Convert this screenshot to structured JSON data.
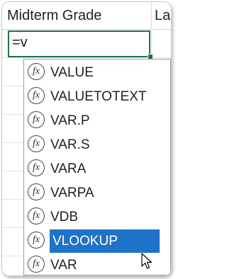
{
  "header": {
    "col1": "Midterm Grade",
    "col2": "La"
  },
  "active_cell": {
    "value": "=v"
  },
  "autocomplete": {
    "items": [
      {
        "label": "VALUE",
        "icon": "fx-icon"
      },
      {
        "label": "VALUETOTEXT",
        "icon": "fx-icon"
      },
      {
        "label": "VAR.P",
        "icon": "fx-icon"
      },
      {
        "label": "VAR.S",
        "icon": "fx-icon"
      },
      {
        "label": "VARA",
        "icon": "fx-icon"
      },
      {
        "label": "VARPA",
        "icon": "fx-icon"
      },
      {
        "label": "VDB",
        "icon": "fx-icon"
      },
      {
        "label": "VLOOKUP",
        "icon": "fx-icon",
        "selected": true
      },
      {
        "label": "VAR",
        "icon": "fx-icon"
      }
    ],
    "fx_glyph": "fx"
  },
  "colors": {
    "accent": "#217346",
    "selection": "#1e73c8"
  }
}
